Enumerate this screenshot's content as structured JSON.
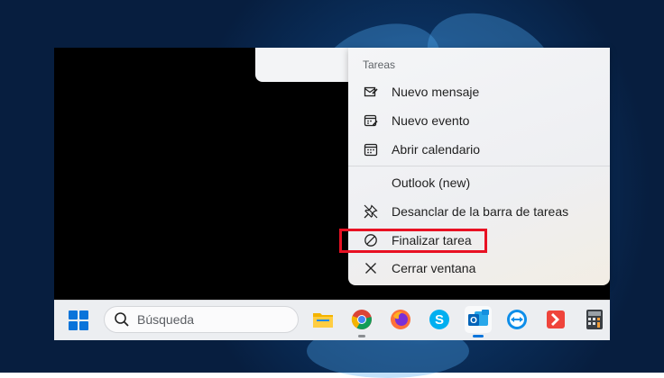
{
  "jumplist": {
    "section_header": "Tareas",
    "tasks": [
      {
        "label": "Nuevo mensaje",
        "icon": "new-message-icon"
      },
      {
        "label": "Nuevo evento",
        "icon": "new-event-icon"
      },
      {
        "label": "Abrir calendario",
        "icon": "calendar-icon"
      }
    ],
    "app_name": "Outlook (new)",
    "unpin_label": "Desanclar de la barra de tareas",
    "end_task_label": "Finalizar tarea",
    "close_window_label": "Cerrar ventana"
  },
  "taskbar": {
    "search_placeholder": "Búsqueda",
    "apps": [
      {
        "name": "file-explorer-icon",
        "running": false
      },
      {
        "name": "chrome-icon",
        "running": true
      },
      {
        "name": "firefox-icon",
        "running": false
      },
      {
        "name": "skype-icon",
        "running": false
      },
      {
        "name": "outlook-icon",
        "running": true,
        "active": true
      },
      {
        "name": "teamviewer-icon",
        "running": false
      },
      {
        "name": "anydesk-icon",
        "running": false
      },
      {
        "name": "calculator-icon",
        "running": false
      }
    ]
  },
  "colors": {
    "accent": "#0a74da",
    "highlight": "#e81123"
  }
}
